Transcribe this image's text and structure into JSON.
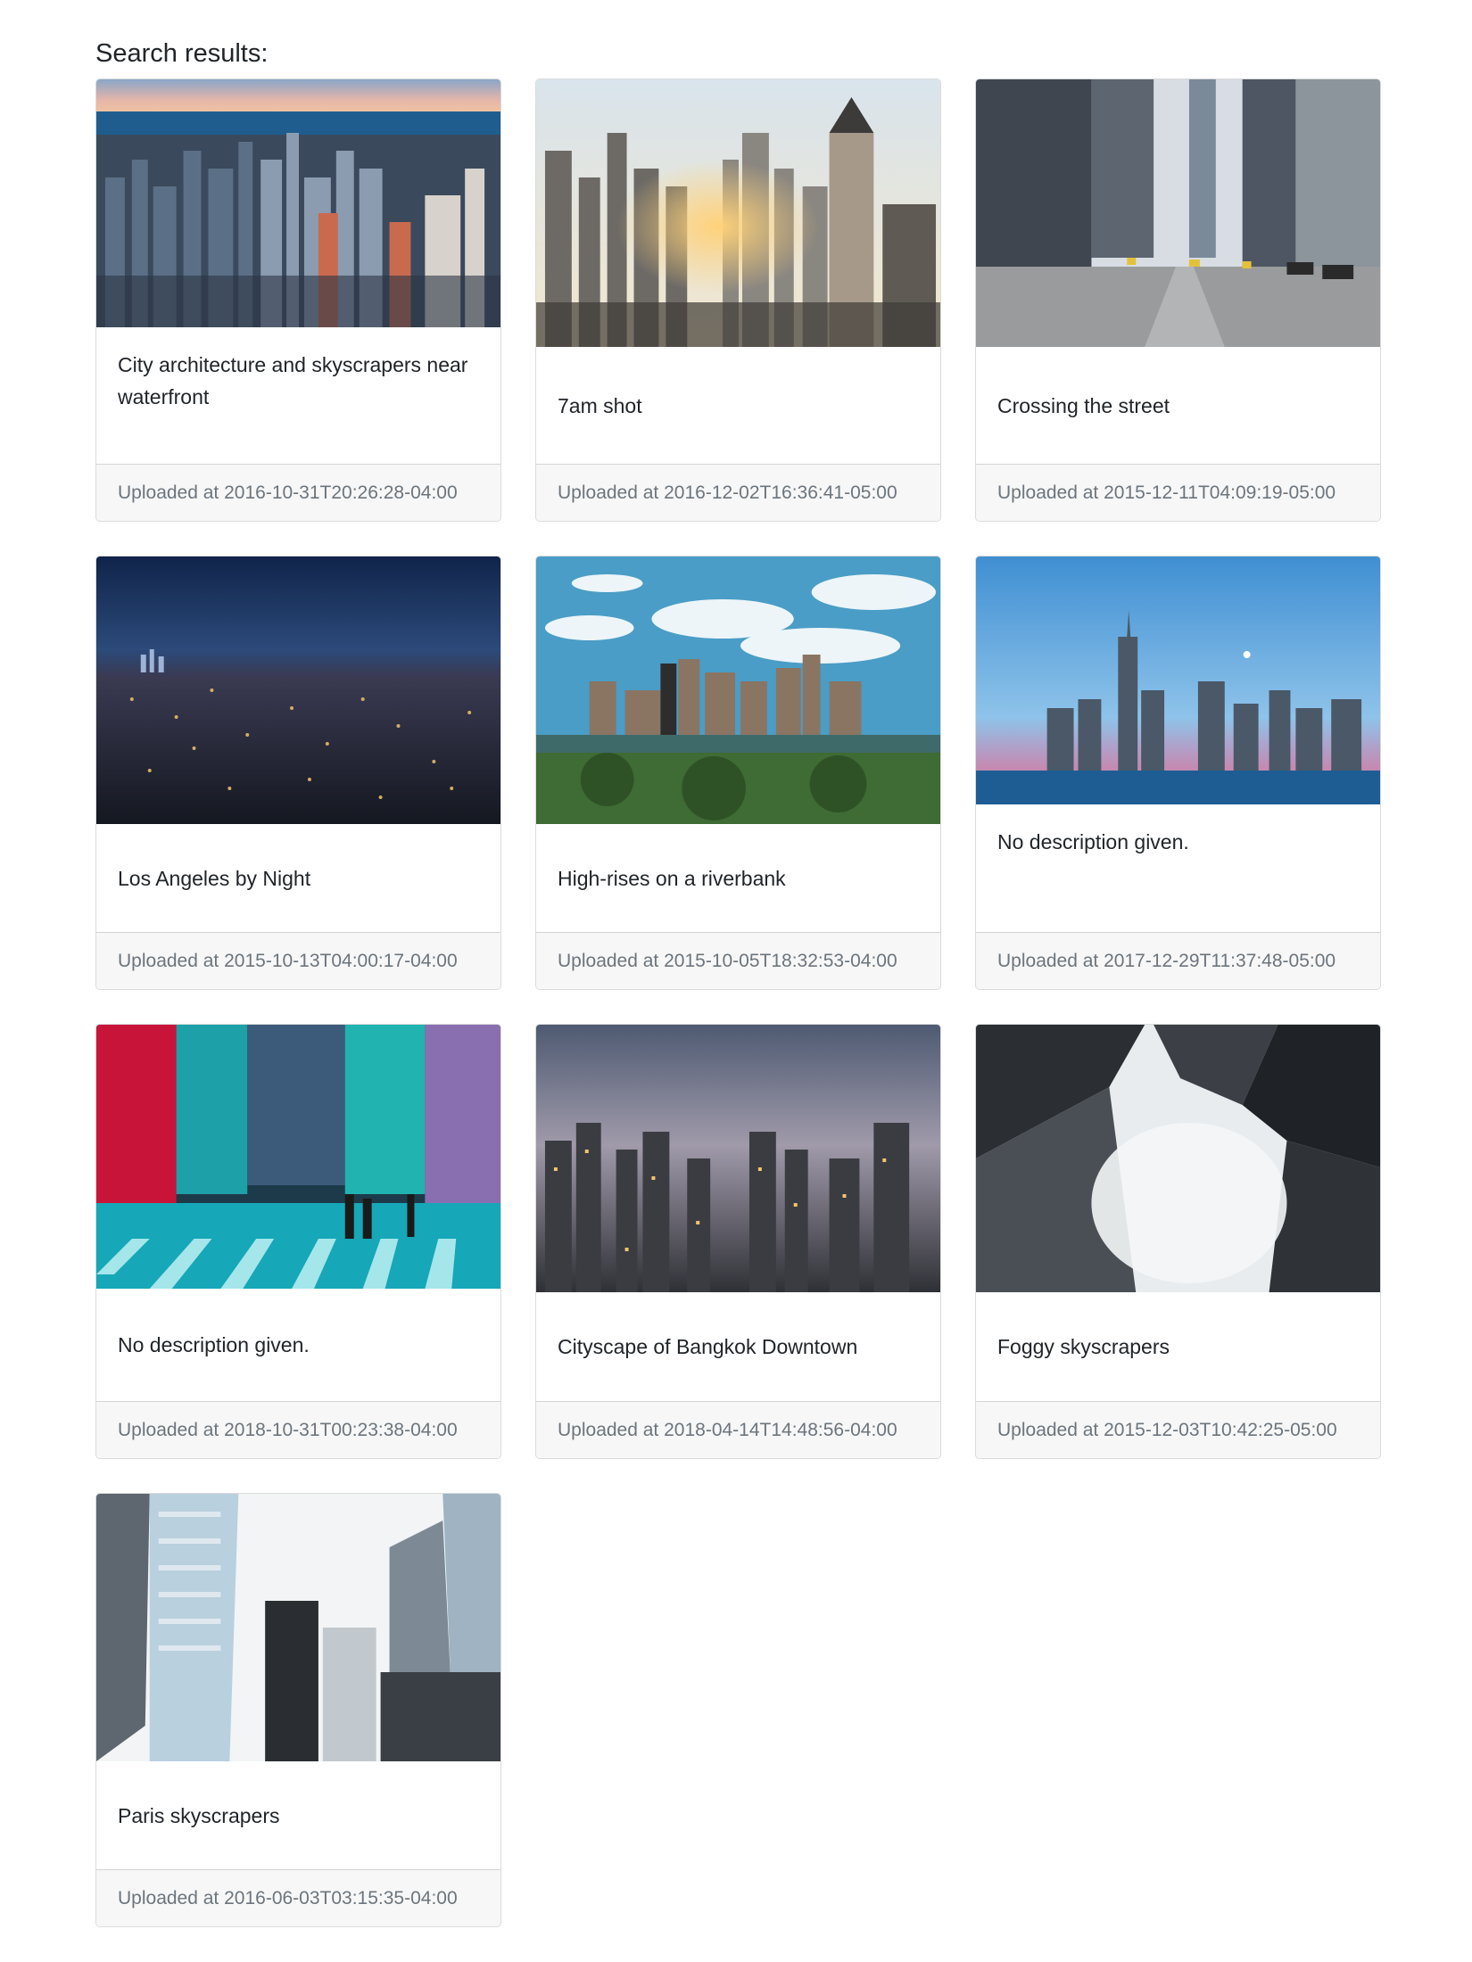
{
  "page": {
    "heading": "Search results:"
  },
  "results": [
    {
      "image_alt": "City architecture and skyscrapers near waterfront",
      "description": "City architecture and skyscrapers near waterfront",
      "uploaded_prefix": "Uploaded at",
      "uploaded": "2016-10-31T20:26:28-04:00"
    },
    {
      "image_alt": "7am shot",
      "description": "7am shot",
      "uploaded_prefix": "Uploaded at",
      "uploaded": "2016-12-02T16:36:41-05:00"
    },
    {
      "image_alt": "Crossing the street",
      "description": "Crossing the street",
      "uploaded_prefix": "Uploaded at",
      "uploaded": "2015-12-11T04:09:19-05:00"
    },
    {
      "image_alt": "Los Angeles by Night",
      "description": "Los Angeles by Night",
      "uploaded_prefix": "Uploaded at",
      "uploaded": "2015-10-13T04:00:17-04:00"
    },
    {
      "image_alt": "High-rises on a riverbank",
      "description": "High-rises on a riverbank",
      "uploaded_prefix": "Uploaded at",
      "uploaded": "2015-10-05T18:32:53-04:00"
    },
    {
      "image_alt": "No description given.",
      "description": "No description given.",
      "uploaded_prefix": "Uploaded at",
      "uploaded": "2017-12-29T11:37:48-05:00"
    },
    {
      "image_alt": "No description given.",
      "description": "No description given.",
      "uploaded_prefix": "Uploaded at",
      "uploaded": "2018-10-31T00:23:38-04:00"
    },
    {
      "image_alt": "Cityscape of Bangkok Downtown",
      "description": "Cityscape of Bangkok Downtown",
      "uploaded_prefix": "Uploaded at",
      "uploaded": "2018-04-14T14:48:56-04:00"
    },
    {
      "image_alt": "Foggy skyscrapers",
      "description": "Foggy skyscrapers",
      "uploaded_prefix": "Uploaded at",
      "uploaded": "2015-12-03T10:42:25-05:00"
    },
    {
      "image_alt": "Paris skyscrapers",
      "description": "Paris skyscrapers",
      "uploaded_prefix": "Uploaded at",
      "uploaded": "2016-06-03T03:15:35-04:00"
    }
  ]
}
